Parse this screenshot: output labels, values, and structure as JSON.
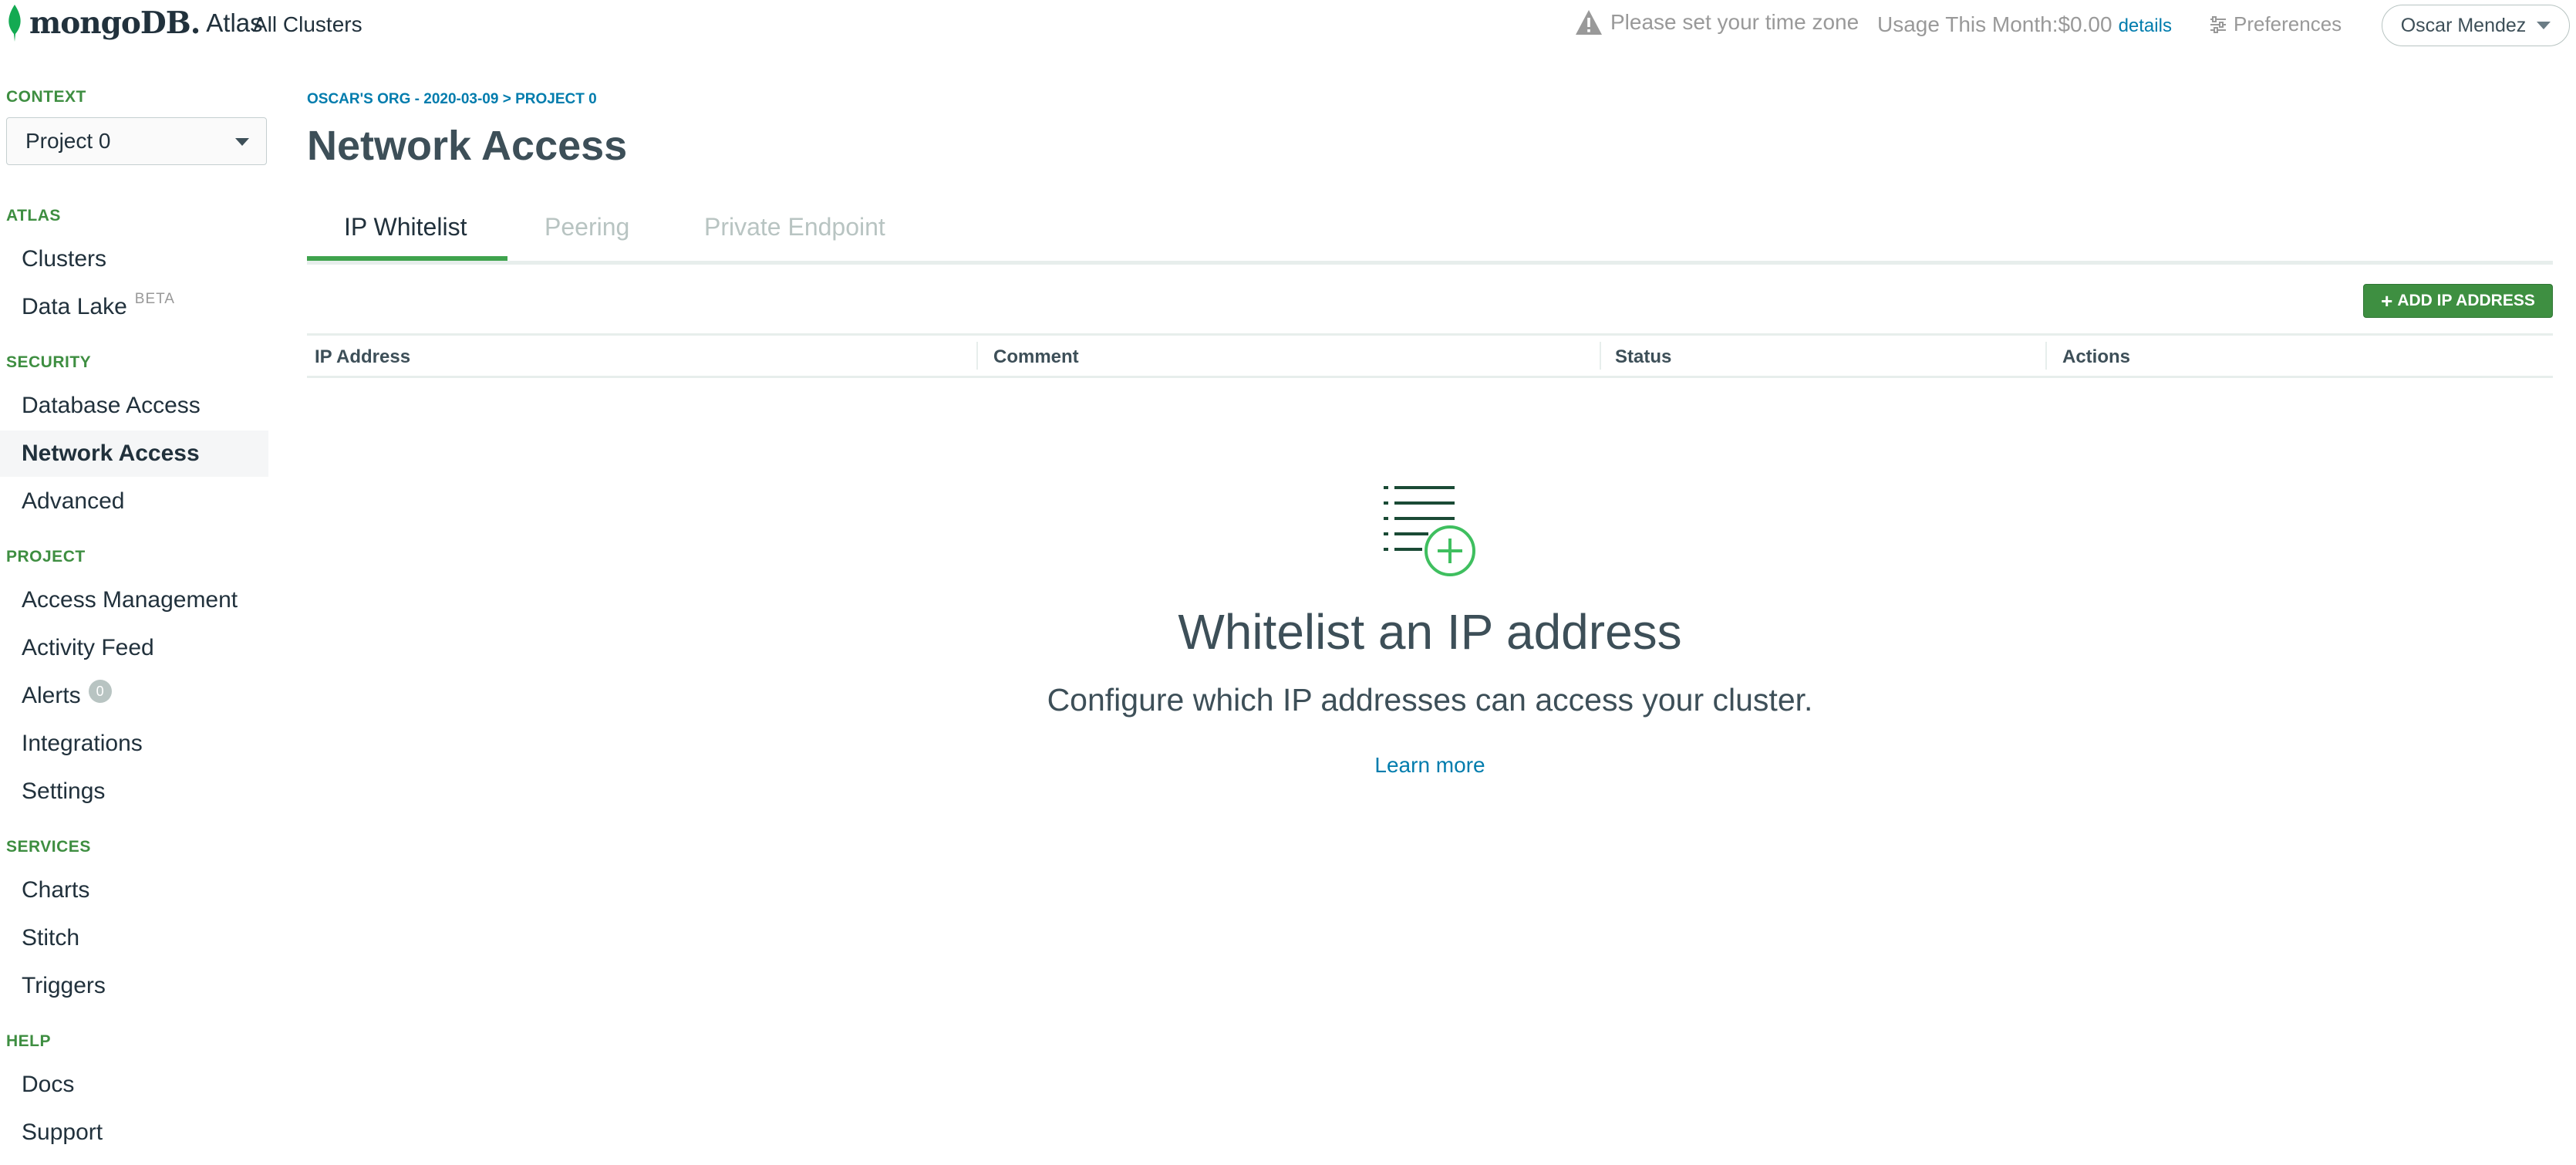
{
  "header": {
    "logo_mongo": "mongoDB.",
    "logo_atlas": "Atlas",
    "all_clusters": "All Clusters",
    "timezone_notice": "Please set your time zone",
    "usage_label": "Usage This Month:$0.00",
    "usage_details": "details",
    "preferences": "Preferences",
    "user_name": "Oscar Mendez"
  },
  "sidebar": {
    "context_label": "CONTEXT",
    "context_value": "Project 0",
    "sections": {
      "atlas": "ATLAS",
      "security": "SECURITY",
      "project": "PROJECT",
      "services": "SERVICES",
      "help": "HELP"
    },
    "items": {
      "clusters": "Clusters",
      "data_lake": "Data Lake",
      "data_lake_badge": "BETA",
      "database_access": "Database Access",
      "network_access": "Network Access",
      "advanced": "Advanced",
      "access_management": "Access Management",
      "activity_feed": "Activity Feed",
      "alerts": "Alerts",
      "alerts_count": "0",
      "integrations": "Integrations",
      "settings": "Settings",
      "charts": "Charts",
      "stitch": "Stitch",
      "triggers": "Triggers",
      "docs": "Docs",
      "support": "Support"
    }
  },
  "main": {
    "breadcrumb": "OSCAR'S ORG - 2020-03-09 > PROJECT 0",
    "title": "Network Access",
    "tabs": [
      "IP Whitelist",
      "Peering",
      "Private Endpoint"
    ],
    "add_button": "ADD IP ADDRESS",
    "columns": [
      "IP Address",
      "Comment",
      "Status",
      "Actions"
    ],
    "empty_title": "Whitelist an IP address",
    "empty_subtitle": "Configure which IP addresses can access your cluster.",
    "learn_more": "Learn more"
  },
  "colors": {
    "brand_green": "#3e8f41",
    "link_blue": "#007cad",
    "text_dark": "#3d4f58",
    "section_green": "#3e8e41"
  }
}
